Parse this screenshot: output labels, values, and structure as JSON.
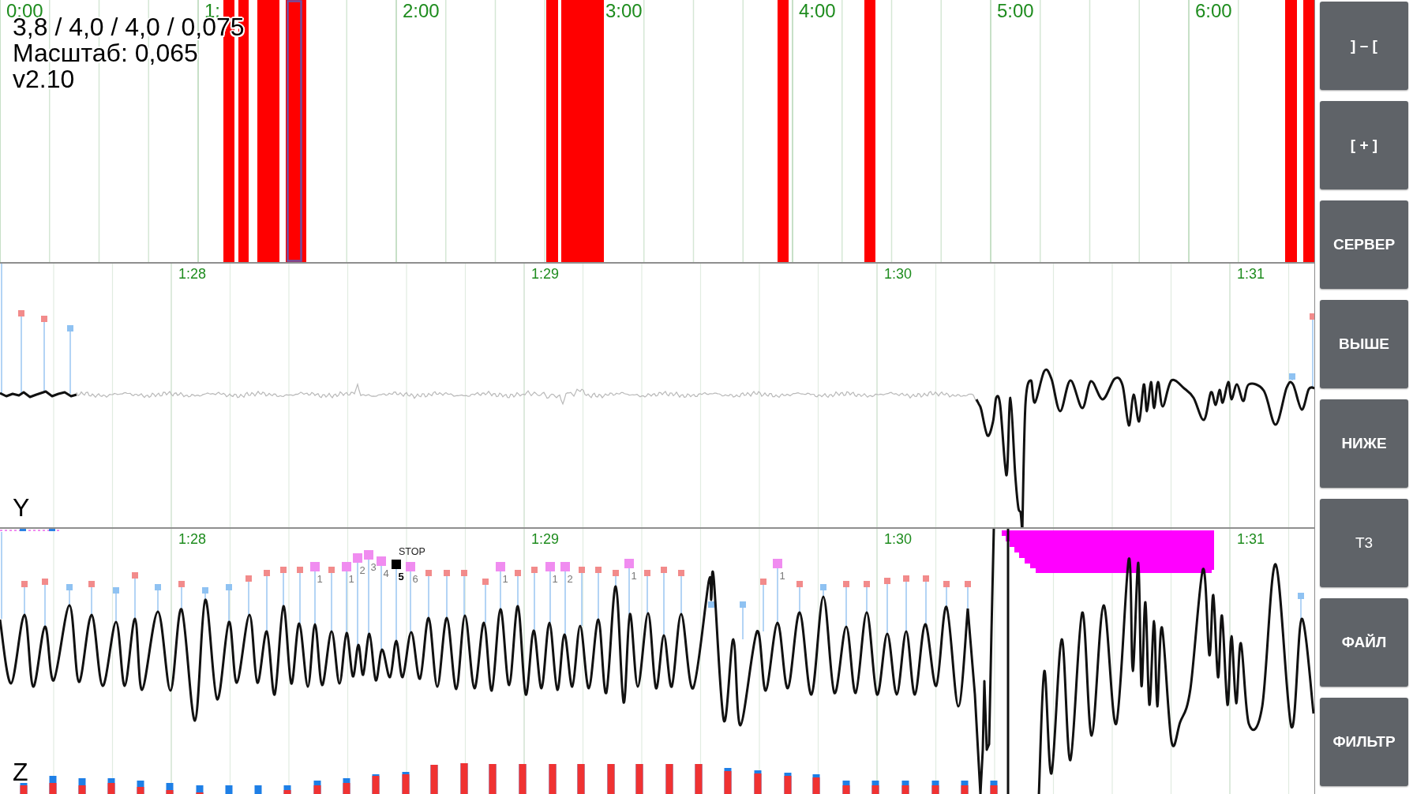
{
  "overview": {
    "status_lines": [
      "3,8 / 4,0 / 4,0 / 0,075",
      "Масштаб: 0,065",
      "v2.10"
    ],
    "time_labels": [
      "0:00",
      "1:",
      "2:00",
      "3:00",
      "4:00",
      "5:00",
      "6:00"
    ]
  },
  "channel_y": {
    "label": "Y",
    "time_labels": [
      "1:28",
      "1:29",
      "1:30",
      "1:31"
    ]
  },
  "channel_z": {
    "label": "Z",
    "time_labels": [
      "1:28",
      "1:29",
      "1:30",
      "1:31"
    ],
    "stop_label": "STOP",
    "markers": [
      {
        "label": "1",
        "selected": false
      },
      {
        "label": "1",
        "selected": false
      },
      {
        "label": "2",
        "selected": false
      },
      {
        "label": "3",
        "selected": false
      },
      {
        "label": "4",
        "selected": false
      },
      {
        "label": "5",
        "selected": true
      },
      {
        "label": "6",
        "selected": false
      },
      {
        "label": "1",
        "selected": false
      },
      {
        "label": "1",
        "selected": false
      },
      {
        "label": "2",
        "selected": false
      },
      {
        "label": "1",
        "selected": false
      },
      {
        "label": "1",
        "selected": false
      }
    ]
  },
  "buttons": [
    {
      "label": "] – [",
      "kind": "command"
    },
    {
      "label": "[ + ]",
      "kind": "command"
    },
    {
      "label": "СЕРВЕР",
      "kind": "command"
    },
    {
      "label": "ВЫШЕ",
      "kind": "command"
    },
    {
      "label": "НИЖЕ",
      "kind": "command"
    },
    {
      "label": "Т3",
      "kind": "toggle"
    },
    {
      "label": "ФАЙЛ",
      "kind": "command"
    },
    {
      "label": "ФИЛЬТР",
      "kind": "command"
    }
  ]
}
